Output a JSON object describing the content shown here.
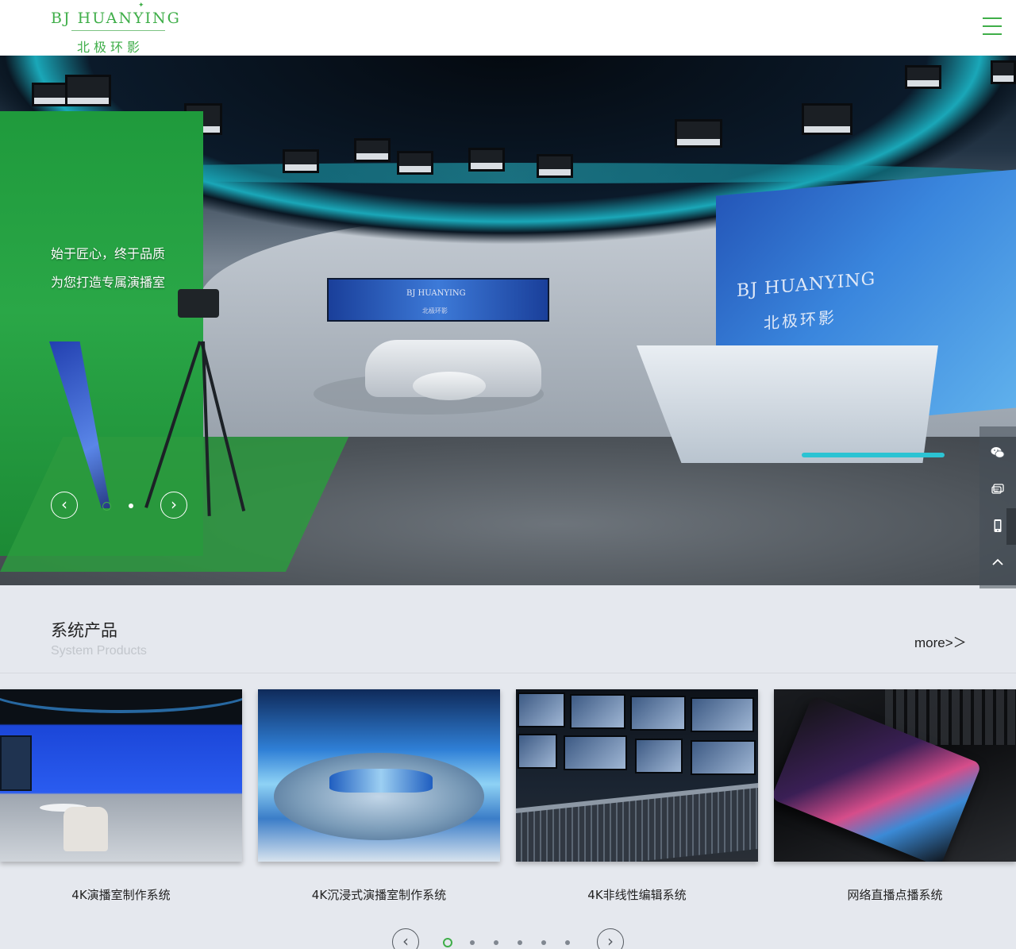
{
  "header": {
    "logo_en": "BJ HUANYING",
    "logo_cn": "北极环影",
    "menu_icon": "hamburger-menu-icon",
    "brand_color": "#3fae49"
  },
  "hero": {
    "line1": "始于匠心，终于品质",
    "line2": "为您打造专属演播室",
    "screen_en": "BJ HUANYING",
    "screen_cn": "北极环影",
    "small_screen_en": "BJ HUANYING",
    "small_screen_cn": "北极环影",
    "prev_arrow": "‹",
    "next_arrow": "›",
    "slide_count": 2,
    "active_slide": 1
  },
  "sidebar": {
    "items": [
      {
        "icon": "wechat-icon"
      },
      {
        "icon": "message-icon"
      },
      {
        "icon": "mobile-phone-icon"
      },
      {
        "icon": "back-to-top-icon"
      }
    ]
  },
  "products": {
    "title": "系统产品",
    "subtitle": "System Products",
    "more_label": "more>＞",
    "items": [
      {
        "label": "4K演播室制作系统"
      },
      {
        "label": "4K沉浸式演播室制作系统"
      },
      {
        "label": "4K非线性编辑系统"
      },
      {
        "label": "网络直播点播系统"
      }
    ],
    "prev_arrow": "‹",
    "next_arrow": "›",
    "page_count": 6,
    "active_page": 1
  }
}
